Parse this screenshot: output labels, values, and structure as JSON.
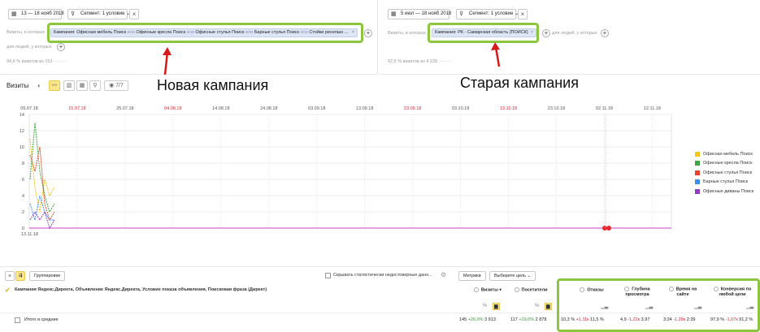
{
  "left_panel": {
    "date_range": "13 — 18 нояб 2018",
    "segment_label": "Сегмент: 1 условие",
    "visits_prefix": "Визиты, в которых",
    "chips": [
      {
        "text": "Кампания: Офисная мебель Поиск"
      },
      {
        "text": "Офисные кресла Поиск"
      },
      {
        "text": "Офисные стулья Поиск"
      },
      {
        "text": "Барные стулья Поиск"
      },
      {
        "text": "Стойки ресепшн ..."
      }
    ],
    "or_word": "или",
    "people_prefix": "для людей, у которых",
    "share_text": "94,8 % визитов из 153"
  },
  "right_panel": {
    "date_range": "5 июл — 18 нояб 2018",
    "segment_label": "Сегмент: 1 условие",
    "visits_prefix": "Визиты, в которых",
    "chip": "Кампания: РК - Самарская область (ПОИСК)",
    "people_prefix": "для людей, у которых",
    "share_text": "92,5 % визитов из 4 228"
  },
  "annotations": {
    "new": "Новая кампания",
    "old": "Старая кампания"
  },
  "toolbar": {
    "metric_title": "Визиты",
    "series_count": "7/7"
  },
  "chart_data": {
    "type": "line",
    "ylim": [
      0,
      14
    ],
    "yticks": [
      0,
      2,
      4,
      6,
      8,
      10,
      12,
      14
    ],
    "xticks": [
      {
        "label": "05.07.18",
        "weekend": false
      },
      {
        "label": "15.07.18",
        "weekend": true
      },
      {
        "label": "25.07.18",
        "weekend": false
      },
      {
        "label": "04.08.18",
        "weekend": true
      },
      {
        "label": "14.08.18",
        "weekend": false
      },
      {
        "label": "24.08.18",
        "weekend": false
      },
      {
        "label": "03.09.18",
        "weekend": false
      },
      {
        "label": "13.09.18",
        "weekend": false
      },
      {
        "label": "23.09.18",
        "weekend": true
      },
      {
        "label": "03.10.18",
        "weekend": false
      },
      {
        "label": "13.10.18",
        "weekend": true
      },
      {
        "label": "23.10.18",
        "weekend": false
      },
      {
        "label": "02.11.18",
        "weekend": false
      },
      {
        "label": "12.11.18",
        "weekend": false
      }
    ],
    "compare_start_label": "13.11.18",
    "series": [
      {
        "name": "Офисная мебель Поиск",
        "color": "#f5c518",
        "values": [
          11,
          5,
          2,
          6,
          4,
          5
        ]
      },
      {
        "name": "Офисные кресла Поиск",
        "color": "#3ea63e",
        "values": [
          6,
          13,
          7,
          4,
          2,
          3
        ]
      },
      {
        "name": "Офисные стулья Поиск",
        "color": "#e8432d",
        "values": [
          9,
          7,
          10,
          3,
          1,
          2
        ]
      },
      {
        "name": "Барные стулья Поиск",
        "color": "#3c8ee8",
        "values": [
          3,
          1,
          4,
          2,
          1,
          1
        ]
      },
      {
        "name": "Офисные диваны Поиск",
        "color": "#8a3fc4",
        "values": [
          1,
          2,
          1,
          2,
          0,
          1
        ]
      }
    ]
  },
  "table": {
    "grouping_label": "Группировки",
    "hide_unreliable": "Скрывать статистически недостоверные данн...",
    "metrics_btn": "Метрики",
    "goal_btn": "Выберите цель",
    "dim_header": "Кампания Яндекс.Директа, Объявление Яндекс.Директа, Условие показа объявления, Поисковая фраза (Директ)",
    "columns": [
      {
        "label": "Визиты"
      },
      {
        "label": "Посетители"
      },
      {
        "label": "Отказы"
      },
      {
        "label": "Глубина просмотра"
      },
      {
        "label": "Время на сайте"
      },
      {
        "label": "Конверсия по любой цели"
      }
    ],
    "totals_label": "Итого и средние",
    "totals": {
      "visits": "145",
      "visits_delta": "+26,9%",
      "visits_cmp": "3 913",
      "users": "117",
      "users_delta": "+29,6%",
      "users_cmp": "2 878",
      "bounce": "10,3 %",
      "bounce_delta": "+1,11к",
      "bounce_cmp": "11,5 %",
      "depth": "4,9",
      "depth_delta": "-1,22к",
      "depth_cmp": "3,97",
      "time": "3:24",
      "time_delta": "-1,28к",
      "time_cmp": "2:39",
      "conv": "97,9 %",
      "conv_delta": "-1,07к",
      "conv_cmp": "91,2 %"
    }
  }
}
